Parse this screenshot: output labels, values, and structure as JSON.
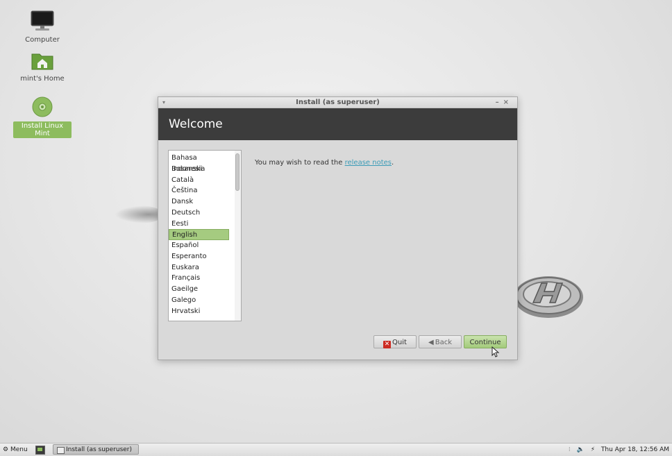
{
  "desktop": {
    "icons": [
      {
        "label": "Computer",
        "icon": "monitor-icon"
      },
      {
        "label": "mint's Home",
        "icon": "home-folder-icon"
      },
      {
        "label": "Install Linux Mint",
        "icon": "disc-icon"
      }
    ]
  },
  "window": {
    "title": "Install (as superuser)",
    "header": "Welcome",
    "languages": [
      "Bahasa Indonesia",
      "Bosanski",
      "Català",
      "Čeština",
      "Dansk",
      "Deutsch",
      "Eesti",
      "English",
      "Español",
      "Esperanto",
      "Euskara",
      "Français",
      "Gaeilge",
      "Galego",
      "Hrvatski"
    ],
    "selected_language": "English",
    "message_prefix": "You may wish to read the",
    "message_link": "release notes",
    "message_suffix": ".",
    "buttons": {
      "quit": "Quit",
      "back": "Back",
      "continue": "Continue"
    }
  },
  "taskbar": {
    "menu_label": "Menu",
    "task_label": "Install (as superuser)",
    "clock": "Thu Apr 18, 12:56 AM"
  },
  "colors": {
    "accent": "#8dbc5e",
    "header_bg": "#3c3c3c",
    "link": "#3a9bb7"
  }
}
